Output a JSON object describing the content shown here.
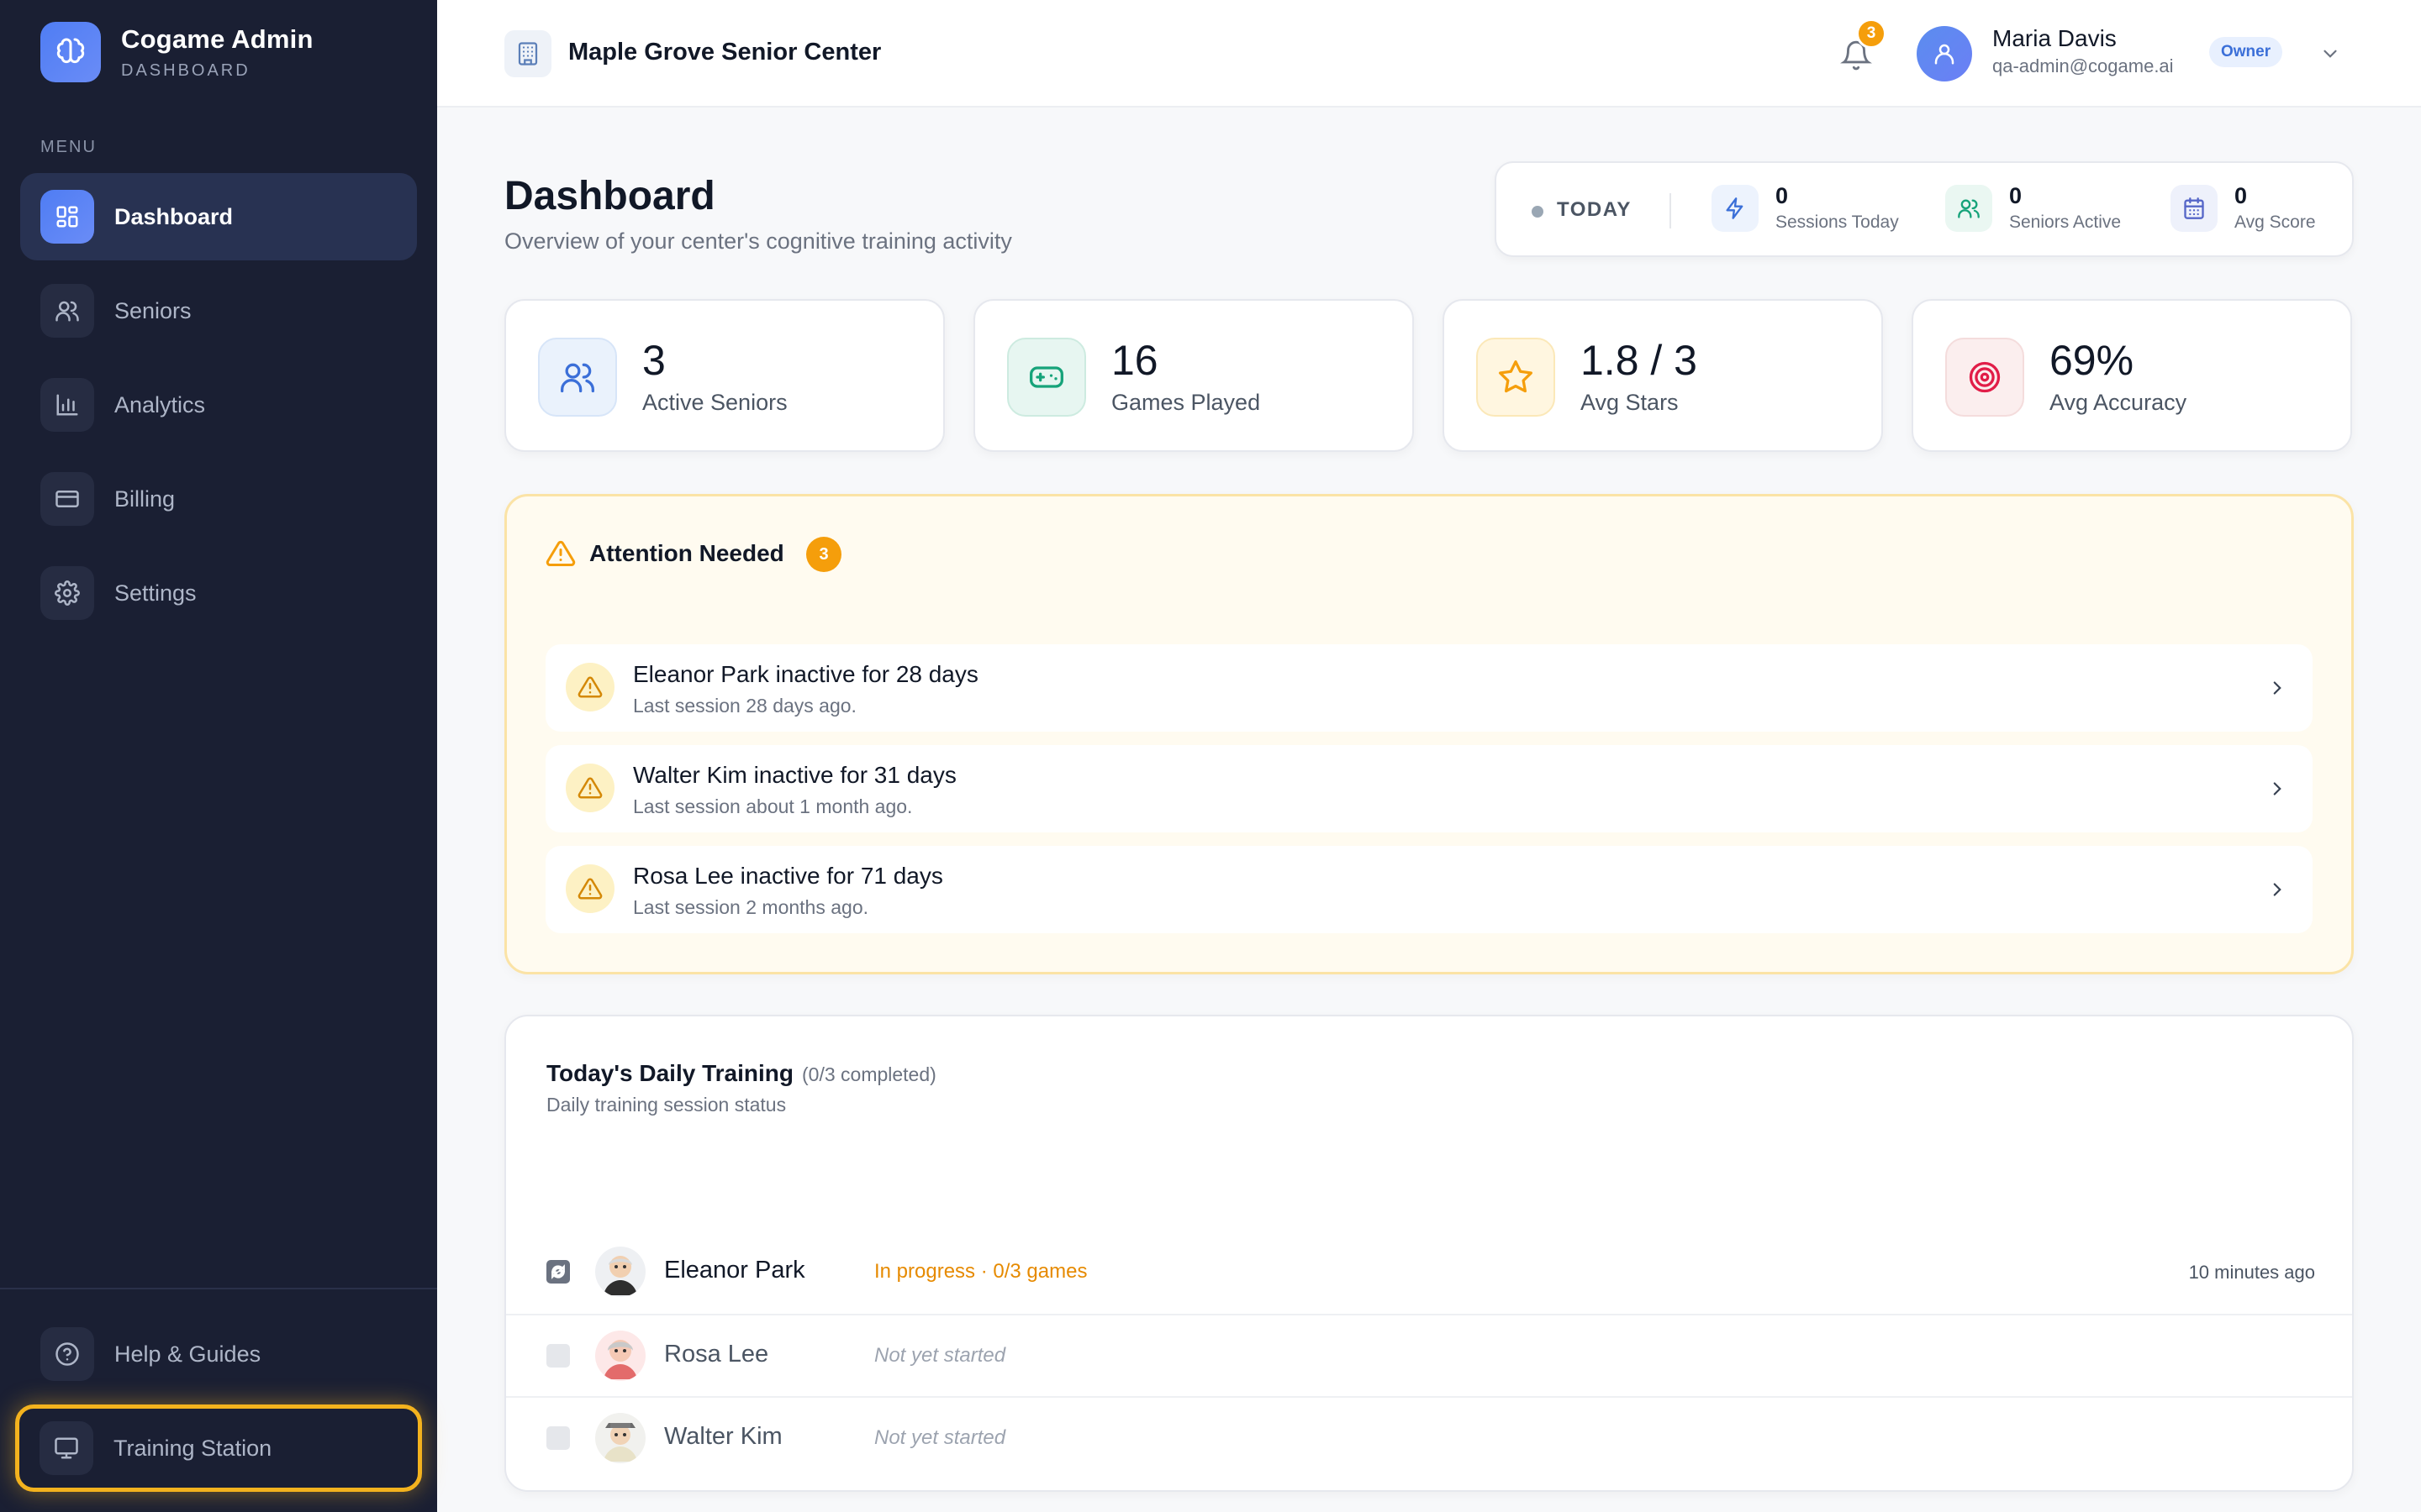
{
  "brand": {
    "title": "Cogame Admin",
    "subtitle": "DASHBOARD",
    "icon": "brain-icon"
  },
  "sidebar": {
    "menu_label": "MENU",
    "items": [
      {
        "label": "Dashboard",
        "icon": "grid-icon",
        "active": true
      },
      {
        "label": "Seniors",
        "icon": "users-icon"
      },
      {
        "label": "Analytics",
        "icon": "bar-chart-icon"
      },
      {
        "label": "Billing",
        "icon": "credit-card-icon"
      },
      {
        "label": "Settings",
        "icon": "gear-icon"
      }
    ],
    "bottom_items": [
      {
        "label": "Help & Guides",
        "icon": "help-circle-icon"
      },
      {
        "label": "Training Station",
        "icon": "monitor-icon",
        "highlighted": true
      }
    ]
  },
  "header": {
    "center_name": "Maple Grove Senior Center",
    "notifications_count": "3",
    "user": {
      "name": "Maria Davis",
      "email": "qa-admin@cogame.ai",
      "role": "Owner"
    }
  },
  "page": {
    "title": "Dashboard",
    "subtitle": "Overview of your center's cognitive training activity"
  },
  "today": {
    "label": "TODAY",
    "metrics": [
      {
        "value": "0",
        "label": "Sessions Today",
        "icon": "lightning-icon"
      },
      {
        "value": "0",
        "label": "Seniors Active",
        "icon": "users-icon"
      },
      {
        "value": "0",
        "label": "Avg Score",
        "icon": "calendar-icon"
      }
    ]
  },
  "stats": [
    {
      "value": "3",
      "label": "Active Seniors",
      "icon": "users-icon"
    },
    {
      "value": "16",
      "label": "Games Played",
      "icon": "gamepad-icon"
    },
    {
      "value": "1.8 / 3",
      "label": "Avg Stars",
      "icon": "star-icon"
    },
    {
      "value": "69%",
      "label": "Avg Accuracy",
      "icon": "target-icon"
    }
  ],
  "attention": {
    "title": "Attention Needed",
    "count": "3",
    "items": [
      {
        "title": "Eleanor Park inactive for 28 days",
        "subtitle": "Last session 28 days ago."
      },
      {
        "title": "Walter Kim inactive for 31 days",
        "subtitle": "Last session about 1 month ago."
      },
      {
        "title": "Rosa Lee inactive for 71 days",
        "subtitle": "Last session 2 months ago."
      }
    ]
  },
  "training": {
    "title": "Today's Daily Training",
    "count": "(0/3 completed)",
    "subtitle": "Daily training session status",
    "rows": [
      {
        "name": "Eleanor Park",
        "status": "In progress · 0/3 games",
        "time": "10 minutes ago"
      },
      {
        "name": "Rosa Lee",
        "status": "Not yet started",
        "time": ""
      },
      {
        "name": "Walter Kim",
        "status": "Not yet started",
        "time": ""
      }
    ]
  },
  "colors": {
    "sidebar_bg": "#1a1f33",
    "accent": "#4f7df3",
    "warning": "#f59e0b",
    "highlight_border": "#f3b21e"
  }
}
